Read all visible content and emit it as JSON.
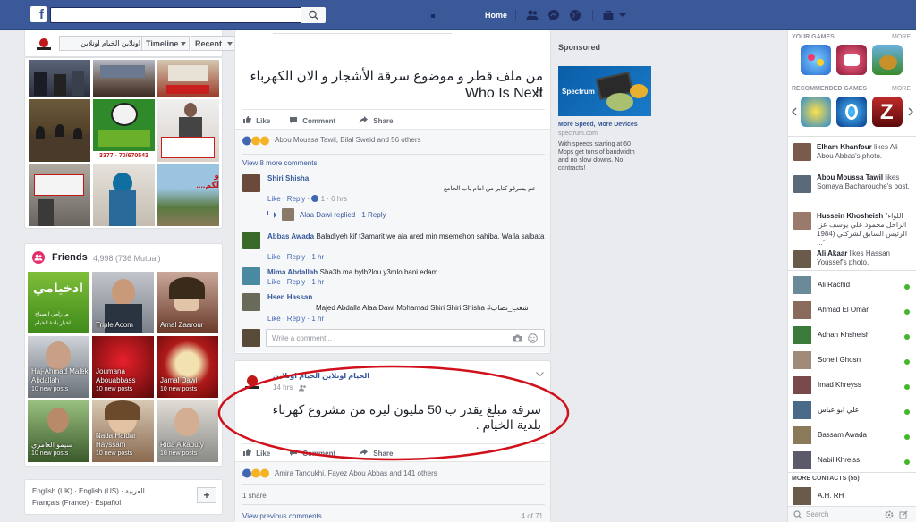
{
  "topbar": {
    "search_placeholder": "",
    "home_label": "Home"
  },
  "profile_bar": {
    "page_name": "الخيام اونلاين الخيام اونلاين",
    "timeline_label": "Timeline",
    "recent_label": "Recent"
  },
  "photos": {
    "tile_text_1": "3377 - 70/670543",
    "tile_text_2": "و لكم...."
  },
  "friends": {
    "title": "Friends",
    "count": "4,998 (736 Mutual)",
    "tiles": [
      {
        "name": "",
        "sub": ""
      },
      {
        "name": "Triple Acom",
        "sub": ""
      },
      {
        "name": "Amal Zaarour",
        "sub": ""
      },
      {
        "name": "Haj-Ahmad Malek Abdallah",
        "sub": "10 new posts"
      },
      {
        "name": "Joumana Abouabbass",
        "sub": "10 new posts"
      },
      {
        "name": "Jamal Dawi",
        "sub": "10 new posts"
      },
      {
        "name": "سيمو العامري",
        "sub": "10 new posts"
      },
      {
        "name": "Nada Haidar Hayssam",
        "sub": "10 new posts"
      },
      {
        "name": "Rida Alkaouty",
        "sub": "10 new posts"
      }
    ]
  },
  "languages": {
    "line1": "English (UK) · English (US) · العربية",
    "line2": "Français (France) · Español",
    "add": "+"
  },
  "post1": {
    "text_ar": "من ملف قطر و موضوع سرقة الأشجار و الان الكهرباء !!",
    "text_en": "Who Is Next",
    "like": "Like",
    "comment": "Comment",
    "share": "Share",
    "reactions": "Abou Moussa Tawil, Bilal Sweid and 56 others",
    "view_more": "View 8 more comments",
    "comments": [
      {
        "name": "Shiri Shisha",
        "text": "عم يسرقو كتاير من امام باب الجامع",
        "actions": "Like · Reply · ",
        "likes": "1",
        "time": "· 6 hrs"
      },
      {
        "name": "Abbas Awada",
        "text": "Baladiyeh kif t3amarit we ala ared min msemehon sahiba. Walla salbata",
        "actions": "Like · Reply · 1 hr"
      },
      {
        "name": "Mima Abdallah",
        "text": "Sha3b ma bylb2lou y3mlo bani edam",
        "actions": "Like · Reply · 1 hr"
      },
      {
        "name": "Hsen Hassan",
        "text": "Majed Abdalla Alaa Dawi Mohamad Shiri Shiri Shisha #شعب_نصاب",
        "actions": "Like · Reply · 1 hr"
      }
    ],
    "reply_line": "Alaa Dawi replied · 1 Reply",
    "write_comment": "Write a comment..."
  },
  "post2": {
    "author": "الخيام اونلاين الخيام اونلاين",
    "time": "14 hrs",
    "text": "سرقة مبلغ يقدر ب 50 مليون ليرة من مشروع كهرباء بلدية الخيام .",
    "like": "Like",
    "comment": "Comment",
    "share": "Share",
    "reactions": "Amira Tanoukhi, Fayez Abou Abbas and 141 others",
    "shares": "1 share",
    "view_prev": "View previous comments",
    "count": "4 of 71"
  },
  "sponsored": {
    "title": "Sponsored",
    "ad_brand": "Spectrum",
    "ad_title": "More Speed, More Devices",
    "ad_domain": "spectrum.com",
    "ad_body": "With speeds starting at 60 Mbps get tons of bandwidth and no slow downs. No contracts!"
  },
  "right": {
    "your_games": "YOUR GAMES",
    "more": "MORE",
    "recommended": "RECOMMENDED GAMES",
    "ticker": [
      {
        "name": "Elham Khanfour",
        "text": " likes Ali Abou Abbas's photo."
      },
      {
        "name": "Abou Moussa Tawil",
        "text": " likes Somaya Bacharouche's post."
      },
      {
        "name": "Hussein Khosheish",
        "text": " \"اللواء الراحل محمود علي يوسف عز، الرئيس السابق لشركتي (1984 ...\""
      },
      {
        "name": "Ali Akaar",
        "text": " likes Hassan Youssef's photo."
      }
    ],
    "online": [
      "Ali Rachid",
      "Ahmad El Omar",
      "Adnan Khsheish",
      "Soheil Ghosn",
      "Imad Khreyss",
      "علي ابو عباس",
      "Bassam Awada",
      "Nabil Khreiss"
    ],
    "more_contacts": "MORE CONTACTS (55)",
    "last_contact": "A.H. RH",
    "search": "Search"
  },
  "colors": {
    "brand": "#3b5998",
    "link": "#365899",
    "online": "#42b72a",
    "annotation": "#d0101a"
  }
}
